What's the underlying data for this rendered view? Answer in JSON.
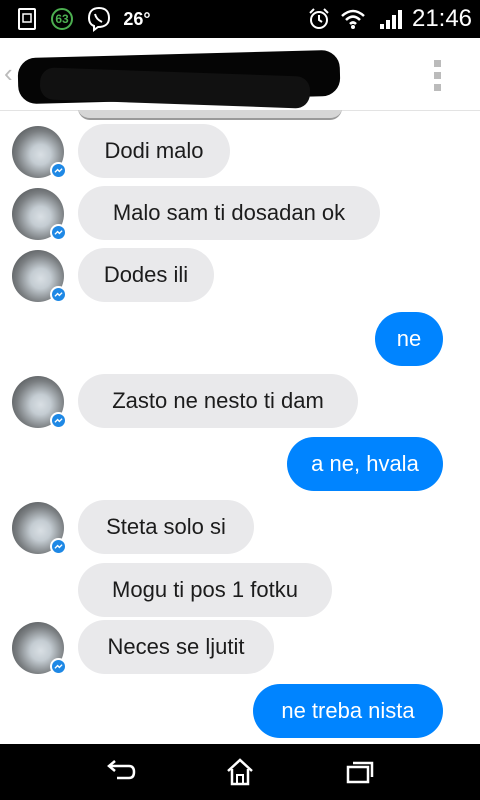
{
  "status_bar": {
    "notification_badge": "63",
    "temperature": "26°",
    "time": "21:46",
    "icons": [
      "screenshot-icon",
      "viber-icon",
      "alarm-icon",
      "wifi-icon",
      "signal-icon"
    ]
  },
  "header": {
    "back_icon": "chevron-left-icon",
    "contact_name_redacted": true,
    "menu_icon": "overflow-menu-icon"
  },
  "messages": [
    {
      "direction": "in",
      "text": "Dodi malo",
      "avatar": true
    },
    {
      "direction": "in",
      "text": "Malo sam ti dosadan ok",
      "avatar": true
    },
    {
      "direction": "in",
      "text": "Dodes ili",
      "avatar": true
    },
    {
      "direction": "out",
      "text": "ne"
    },
    {
      "direction": "in",
      "text": "Zasto ne nesto ti dam",
      "avatar": true
    },
    {
      "direction": "out",
      "text": "a ne, hvala"
    },
    {
      "direction": "in",
      "text": "Steta solo si",
      "avatar": true
    },
    {
      "direction": "in",
      "text": "Mogu ti pos 1 fotku",
      "avatar": false
    },
    {
      "direction": "in",
      "text": "Neces se ljutit",
      "avatar": true
    },
    {
      "direction": "out",
      "text": "ne treba nista"
    }
  ],
  "colors": {
    "incoming_bubble": "#e9e9eb",
    "outgoing_bubble": "#0084ff",
    "messenger_badge": "#1e88e5"
  },
  "nav_bar": {
    "icons": [
      "back-nav-icon",
      "home-nav-icon",
      "recents-nav-icon"
    ]
  }
}
